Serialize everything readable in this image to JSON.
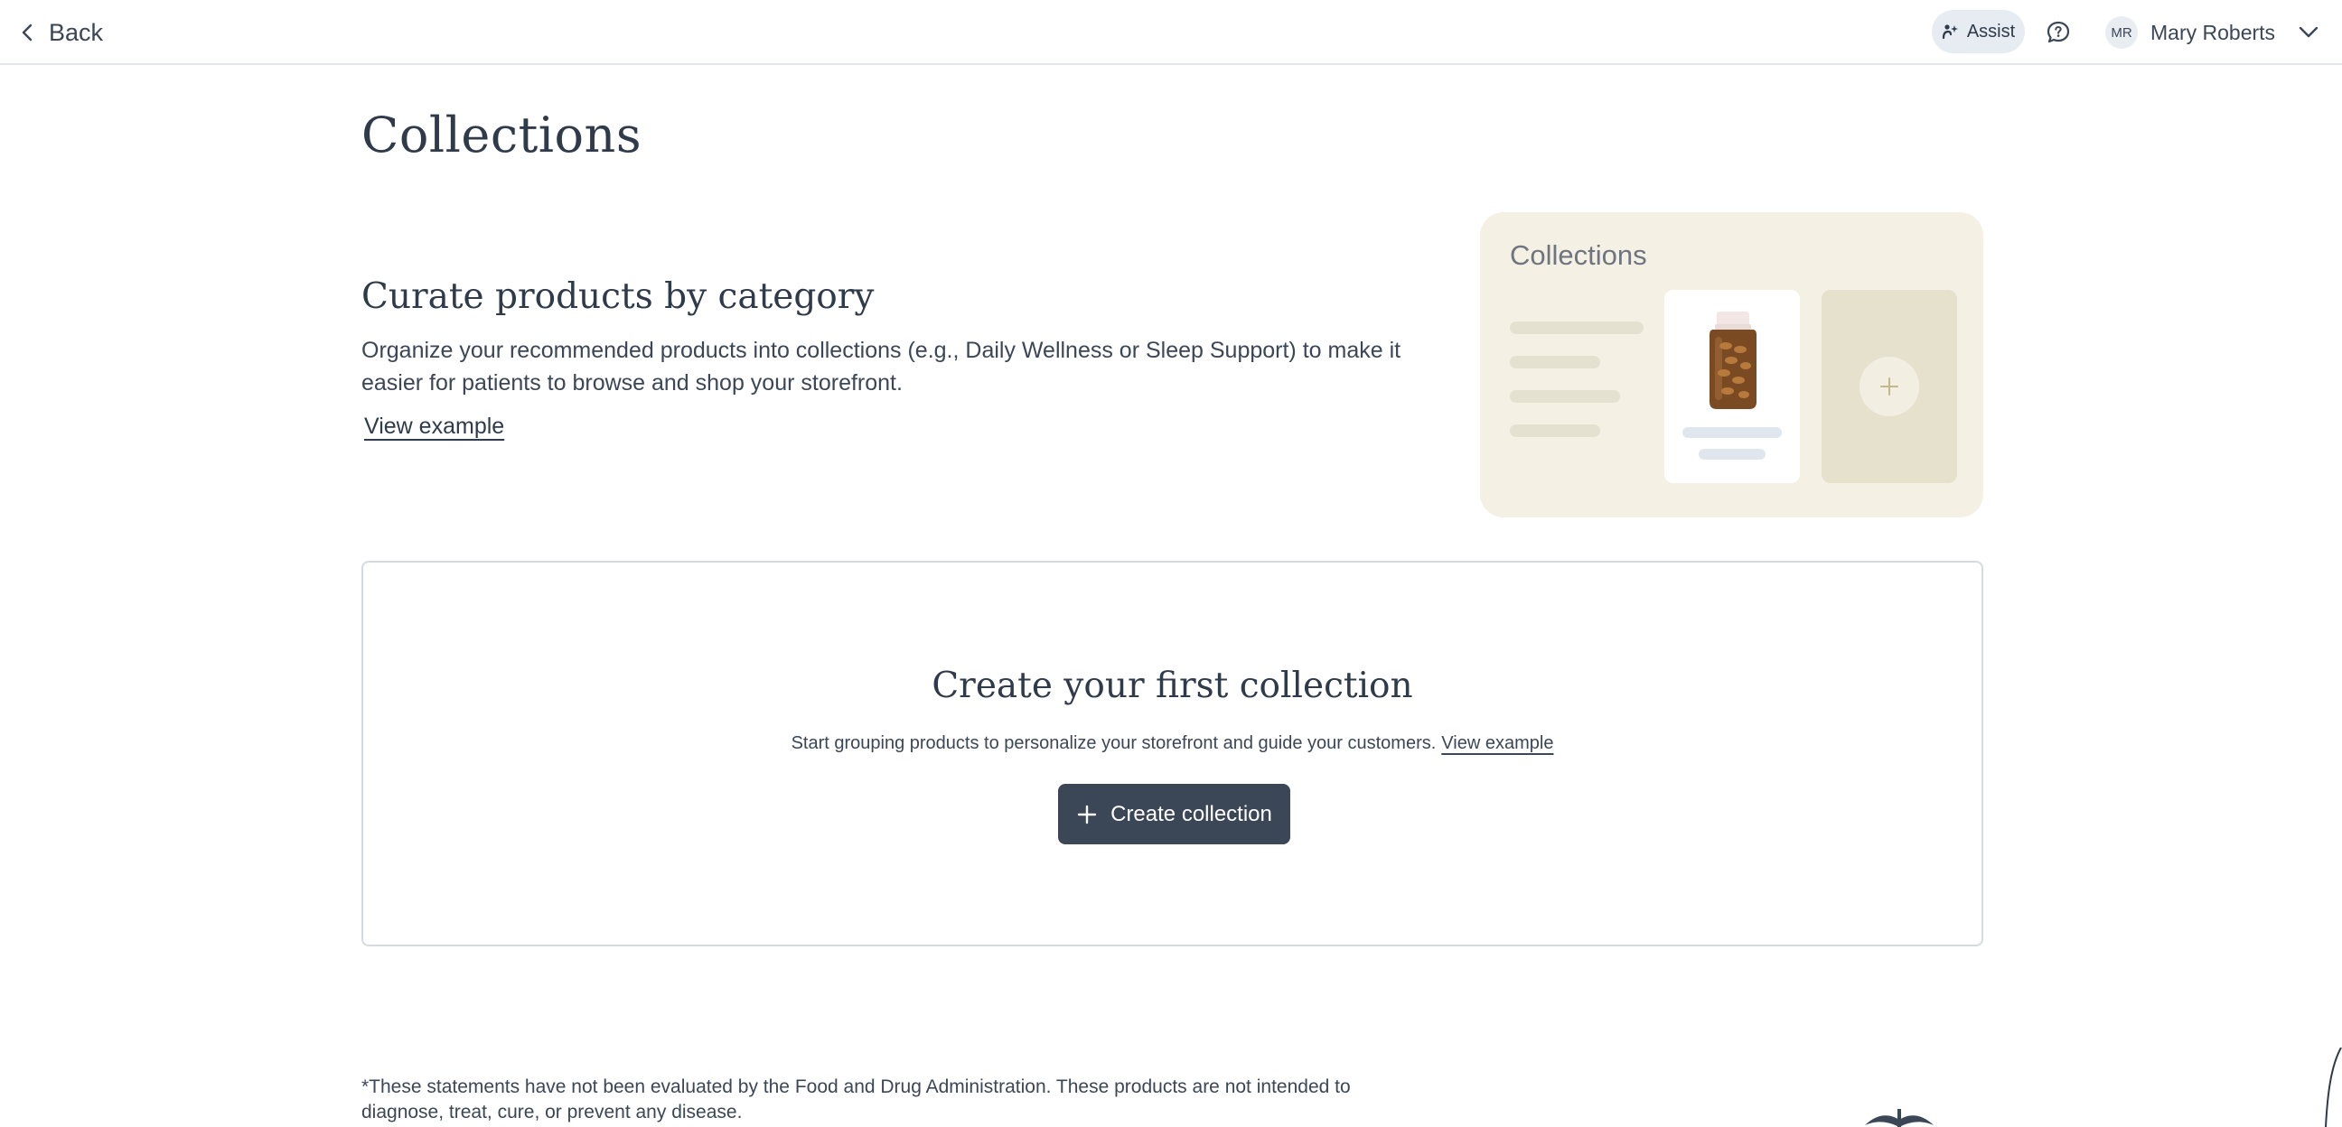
{
  "header": {
    "back_label": "Back",
    "assist_label": "Assist",
    "user": {
      "initials": "MR",
      "name": "Mary Roberts"
    }
  },
  "page": {
    "title": "Collections"
  },
  "intro": {
    "heading": "Curate products by category",
    "body": "Organize your recommended products into collections (e.g., Daily Wellness or Sleep Support) to make it easier for patients to browse and shop your storefront.",
    "link": "View example"
  },
  "illustration": {
    "title": "Collections"
  },
  "empty_state": {
    "title": "Create your first collection",
    "description": "Start grouping products to personalize your storefront and guide your customers.",
    "link": "View example",
    "button_label": "Create collection"
  },
  "footer": {
    "disclaimer": "*These statements have not been evaluated by the Food and Drug Administration. These products are not intended to diagnose, treat, cure, or prevent any disease."
  },
  "colors": {
    "primary_button": "#3b4656",
    "text": "#3b4656",
    "illustration_bg": "#f4f0e4",
    "assist_bg": "#e7ecf2"
  },
  "icons": [
    "chevron-left-icon",
    "assist-icon",
    "chat-bubble-icon",
    "chevron-down-icon",
    "plus-icon",
    "supplement-bottle-icon",
    "caduceus-icon"
  ]
}
